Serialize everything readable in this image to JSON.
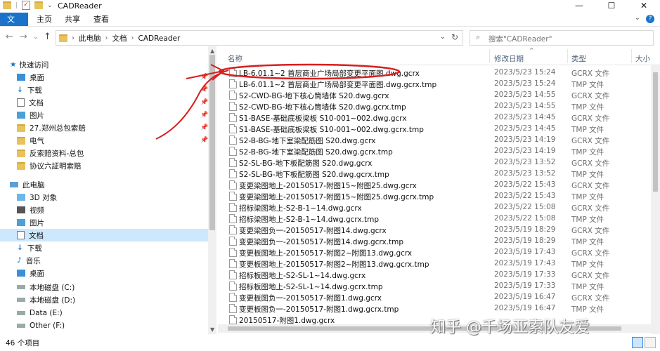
{
  "window": {
    "title": "CADReader",
    "controls": {
      "minimize": "—",
      "maximize": "☐",
      "close": "✕"
    }
  },
  "ribbon": {
    "tabs": [
      "文件",
      "主页",
      "共享",
      "查看"
    ],
    "expand_glyph": "⌄",
    "help_glyph": "?"
  },
  "address": {
    "crumbs": [
      "此电脑",
      "文档",
      "CADReader"
    ],
    "search_placeholder": "搜索\"CADReader\""
  },
  "sidebar": {
    "items": [
      {
        "label": "快速访问",
        "icon": "star-icon"
      },
      {
        "label": "桌面",
        "icon": "desktop-icon"
      },
      {
        "label": "下载",
        "icon": "download-icon"
      },
      {
        "label": "文档",
        "icon": "document-icon"
      },
      {
        "label": "图片",
        "icon": "picture-icon"
      },
      {
        "label": "27.郑州总包索赔",
        "icon": "folder-icon"
      },
      {
        "label": "电气",
        "icon": "folder-icon"
      },
      {
        "label": "反索赔资料-总包",
        "icon": "folder-icon"
      },
      {
        "label": "协议六証明索赔",
        "icon": "folder-icon"
      },
      {
        "label": "此电脑",
        "icon": "computer-icon"
      },
      {
        "label": "3D 对象",
        "icon": "cube-icon"
      },
      {
        "label": "视频",
        "icon": "video-icon"
      },
      {
        "label": "图片",
        "icon": "picture-icon"
      },
      {
        "label": "文档",
        "icon": "document-icon"
      },
      {
        "label": "下载",
        "icon": "download-icon"
      },
      {
        "label": "音乐",
        "icon": "music-icon"
      },
      {
        "label": "桌面",
        "icon": "desktop-icon"
      },
      {
        "label": "本地磁盘 (C:)",
        "icon": "drive-icon"
      },
      {
        "label": "本地磁盘 (D:)",
        "icon": "drive-icon"
      },
      {
        "label": "Data (E:)",
        "icon": "drive-icon"
      },
      {
        "label": "Other (F:)",
        "icon": "drive-icon"
      }
    ]
  },
  "columns": {
    "name": "名称",
    "date": "修改日期",
    "type": "类型",
    "size": "大小"
  },
  "files": [
    {
      "name": "LB-6.01.1~2 首层商业广场局部变更平面图.dwg.gcrx",
      "date": "2023/5/23 15:24",
      "type": "GCRX 文件"
    },
    {
      "name": "LB-6.01.1~2 首层商业广场局部变更平面图.dwg.gcrx.tmp",
      "date": "2023/5/23 15:24",
      "type": "TMP 文件"
    },
    {
      "name": "S2-CWD-BG-地下核心筒墙体 S20.dwg.gcrx",
      "date": "2023/5/23 14:55",
      "type": "GCRX 文件"
    },
    {
      "name": "S2-CWD-BG-地下核心筒墙体 S20.dwg.gcrx.tmp",
      "date": "2023/5/23 14:55",
      "type": "TMP 文件"
    },
    {
      "name": "S1-BASE-基础底板梁板 S10-001~002.dwg.gcrx",
      "date": "2023/5/23 14:45",
      "type": "GCRX 文件"
    },
    {
      "name": "S1-BASE-基础底板梁板 S10-001~002.dwg.gcrx.tmp",
      "date": "2023/5/23 14:45",
      "type": "TMP 文件"
    },
    {
      "name": "S2-B-BG-地下室梁配筋图 S20.dwg.gcrx",
      "date": "2023/5/23 14:19",
      "type": "GCRX 文件"
    },
    {
      "name": "S2-B-BG-地下室梁配筋图 S20.dwg.gcrx.tmp",
      "date": "2023/5/23 14:19",
      "type": "TMP 文件"
    },
    {
      "name": "S2-SL-BG-地下板配筋图 S20.dwg.gcrx",
      "date": "2023/5/23 13:52",
      "type": "GCRX 文件"
    },
    {
      "name": "S2-SL-BG-地下板配筋图 S20.dwg.gcrx.tmp",
      "date": "2023/5/23 13:52",
      "type": "TMP 文件"
    },
    {
      "name": "变更梁图地上-20150517-附图15~附图25.dwg.gcrx",
      "date": "2023/5/22 15:43",
      "type": "GCRX 文件"
    },
    {
      "name": "变更梁图地上-20150517-附图15~附图25.dwg.gcrx.tmp",
      "date": "2023/5/22 15:43",
      "type": "TMP 文件"
    },
    {
      "name": "招标梁图地上-S2-B-1~14.dwg.gcrx",
      "date": "2023/5/22 15:08",
      "type": "GCRX 文件"
    },
    {
      "name": "招标梁图地上-S2-B-1~14.dwg.gcrx.tmp",
      "date": "2023/5/22 15:08",
      "type": "TMP 文件"
    },
    {
      "name": "变更梁图负一-20150517-附图14.dwg.gcrx",
      "date": "2023/5/19 18:29",
      "type": "GCRX 文件"
    },
    {
      "name": "变更梁图负一-20150517-附图14.dwg.gcrx.tmp",
      "date": "2023/5/19 18:29",
      "type": "TMP 文件"
    },
    {
      "name": "变更板图地上-20150517-附图2~附图13.dwg.gcrx",
      "date": "2023/5/19 17:43",
      "type": "GCRX 文件"
    },
    {
      "name": "变更板图地上-20150517-附图2~附图13.dwg.gcrx.tmp",
      "date": "2023/5/19 17:43",
      "type": "TMP 文件"
    },
    {
      "name": "招标板图地上-S2-SL-1~14.dwg.gcrx",
      "date": "2023/5/19 17:33",
      "type": "GCRX 文件"
    },
    {
      "name": "招标板图地上-S2-SL-1~14.dwg.gcrx.tmp",
      "date": "2023/5/19 17:33",
      "type": "TMP 文件"
    },
    {
      "name": "变更板图负一-20150517-附图1.dwg.gcrx",
      "date": "2023/5/19 16:47",
      "type": "GCRX 文件"
    },
    {
      "name": "变更板图负一-20150517-附图1.dwg.gcrx.tmp",
      "date": "2023/5/19 16:47",
      "type": "TMP 文件"
    },
    {
      "name": "20150517-附图1.dwg.gcrx",
      "date": "",
      "type": ""
    }
  ],
  "status": {
    "count": "46 个项目"
  },
  "watermark": "知乎 @千场亚索队友爱",
  "colors": {
    "accent": "#1a73c9",
    "selected": "#cce8ff",
    "annotation": "#d81e1e"
  }
}
